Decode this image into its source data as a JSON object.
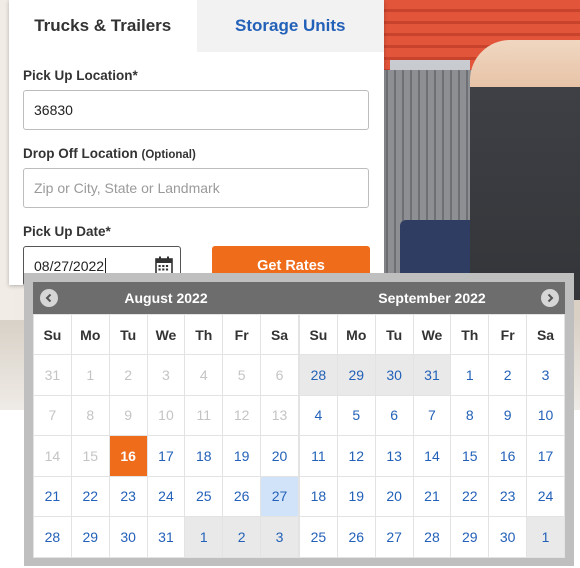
{
  "tabs": [
    {
      "label": "Trucks & Trailers",
      "active": true
    },
    {
      "label": "Storage Units",
      "active": false
    }
  ],
  "form": {
    "pickup_label": "Pick Up Location*",
    "pickup_value": "36830",
    "dropoff_label": "Drop Off Location",
    "dropoff_optional": "(Optional)",
    "dropoff_placeholder": "Zip or City, State or Landmark",
    "date_label": "Pick Up Date*",
    "date_value": "08/27/2022",
    "submit_label": "Get Rates"
  },
  "calendar": {
    "weekdays": [
      "Su",
      "Mo",
      "Tu",
      "We",
      "Th",
      "Fr",
      "Sa"
    ],
    "months": [
      {
        "title": "August 2022",
        "weeks": [
          [
            {
              "d": "31",
              "s": "muted"
            },
            {
              "d": "1",
              "s": "muted"
            },
            {
              "d": "2",
              "s": "muted"
            },
            {
              "d": "3",
              "s": "muted"
            },
            {
              "d": "4",
              "s": "muted"
            },
            {
              "d": "5",
              "s": "muted"
            },
            {
              "d": "6",
              "s": "muted"
            }
          ],
          [
            {
              "d": "7",
              "s": "muted"
            },
            {
              "d": "8",
              "s": "muted"
            },
            {
              "d": "9",
              "s": "muted"
            },
            {
              "d": "10",
              "s": "muted"
            },
            {
              "d": "11",
              "s": "muted"
            },
            {
              "d": "12",
              "s": "muted"
            },
            {
              "d": "13",
              "s": "muted"
            }
          ],
          [
            {
              "d": "14",
              "s": "muted"
            },
            {
              "d": "15",
              "s": "muted"
            },
            {
              "d": "16",
              "s": "today"
            },
            {
              "d": "17",
              "s": ""
            },
            {
              "d": "18",
              "s": ""
            },
            {
              "d": "19",
              "s": ""
            },
            {
              "d": "20",
              "s": ""
            }
          ],
          [
            {
              "d": "21",
              "s": ""
            },
            {
              "d": "22",
              "s": ""
            },
            {
              "d": "23",
              "s": ""
            },
            {
              "d": "24",
              "s": ""
            },
            {
              "d": "25",
              "s": ""
            },
            {
              "d": "26",
              "s": ""
            },
            {
              "d": "27",
              "s": "hover"
            }
          ],
          [
            {
              "d": "28",
              "s": ""
            },
            {
              "d": "29",
              "s": ""
            },
            {
              "d": "30",
              "s": ""
            },
            {
              "d": "31",
              "s": ""
            },
            {
              "d": "1",
              "s": "other"
            },
            {
              "d": "2",
              "s": "other"
            },
            {
              "d": "3",
              "s": "other"
            }
          ]
        ]
      },
      {
        "title": "September 2022",
        "weeks": [
          [
            {
              "d": "28",
              "s": "other"
            },
            {
              "d": "29",
              "s": "other"
            },
            {
              "d": "30",
              "s": "other"
            },
            {
              "d": "31",
              "s": "other"
            },
            {
              "d": "1",
              "s": ""
            },
            {
              "d": "2",
              "s": ""
            },
            {
              "d": "3",
              "s": ""
            }
          ],
          [
            {
              "d": "4",
              "s": ""
            },
            {
              "d": "5",
              "s": ""
            },
            {
              "d": "6",
              "s": ""
            },
            {
              "d": "7",
              "s": ""
            },
            {
              "d": "8",
              "s": ""
            },
            {
              "d": "9",
              "s": ""
            },
            {
              "d": "10",
              "s": ""
            }
          ],
          [
            {
              "d": "11",
              "s": ""
            },
            {
              "d": "12",
              "s": ""
            },
            {
              "d": "13",
              "s": ""
            },
            {
              "d": "14",
              "s": ""
            },
            {
              "d": "15",
              "s": ""
            },
            {
              "d": "16",
              "s": ""
            },
            {
              "d": "17",
              "s": ""
            }
          ],
          [
            {
              "d": "18",
              "s": ""
            },
            {
              "d": "19",
              "s": ""
            },
            {
              "d": "20",
              "s": ""
            },
            {
              "d": "21",
              "s": ""
            },
            {
              "d": "22",
              "s": ""
            },
            {
              "d": "23",
              "s": ""
            },
            {
              "d": "24",
              "s": ""
            }
          ],
          [
            {
              "d": "25",
              "s": ""
            },
            {
              "d": "26",
              "s": ""
            },
            {
              "d": "27",
              "s": ""
            },
            {
              "d": "28",
              "s": ""
            },
            {
              "d": "29",
              "s": ""
            },
            {
              "d": "30",
              "s": ""
            },
            {
              "d": "1",
              "s": "other"
            }
          ]
        ]
      }
    ],
    "icons": {
      "prev": "chevron-left-icon",
      "next": "chevron-right-icon",
      "date": "calendar-icon"
    }
  },
  "colors": {
    "accent": "#ef6c1a",
    "link": "#2361b8",
    "header": "#6d6d6d",
    "hover": "#d1e3f8"
  }
}
